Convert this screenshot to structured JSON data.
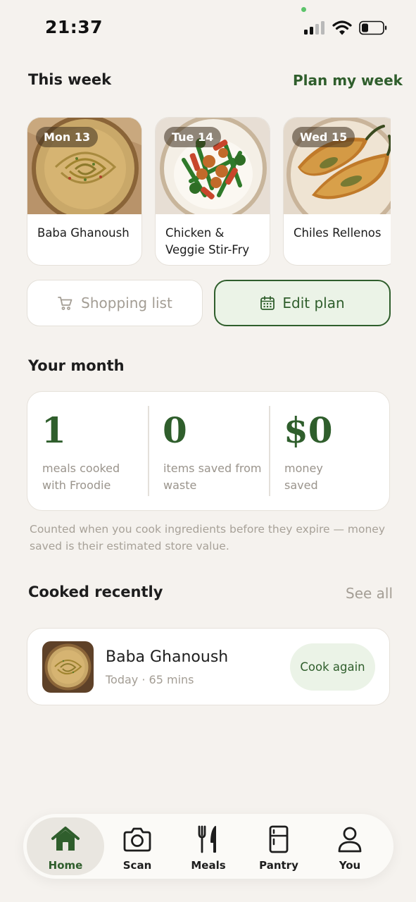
{
  "status_bar": {
    "time": "21:37"
  },
  "this_week": {
    "title": "This week",
    "plan_link": "Plan my week",
    "days": [
      {
        "day": "Mon 13",
        "dish": "Baba Ghanoush"
      },
      {
        "day": "Tue 14",
        "dish": "Chicken & Veggie Stir-Fry"
      },
      {
        "day": "Wed 15",
        "dish": "Chiles Rellenos"
      }
    ]
  },
  "actions": {
    "shopping_list": "Shopping list",
    "edit_plan": "Edit plan"
  },
  "month": {
    "title": "Your month",
    "stats": [
      {
        "value": "1",
        "label": "meals cooked with Froodie"
      },
      {
        "value": "0",
        "label": "items saved from waste"
      },
      {
        "value": "$0",
        "label": "money saved"
      }
    ],
    "note": "Counted when you cook ingredients before they expire — money saved is their estimated store value."
  },
  "recent": {
    "title": "Cooked recently",
    "see_all": "See all",
    "items": [
      {
        "name": "Baba Ghanoush",
        "meta": "Today · 65 mins",
        "action": "Cook again"
      }
    ]
  },
  "nav": {
    "items": [
      {
        "label": "Home",
        "icon": "home-icon",
        "active": true
      },
      {
        "label": "Scan",
        "icon": "camera-icon"
      },
      {
        "label": "Meals",
        "icon": "fork-knife-icon"
      },
      {
        "label": "Pantry",
        "icon": "fridge-icon"
      },
      {
        "label": "You",
        "icon": "person-icon"
      }
    ]
  },
  "colors": {
    "accent": "#2f5e2c",
    "accent_bg": "#ebf3e7",
    "background": "#f5f2ee"
  }
}
